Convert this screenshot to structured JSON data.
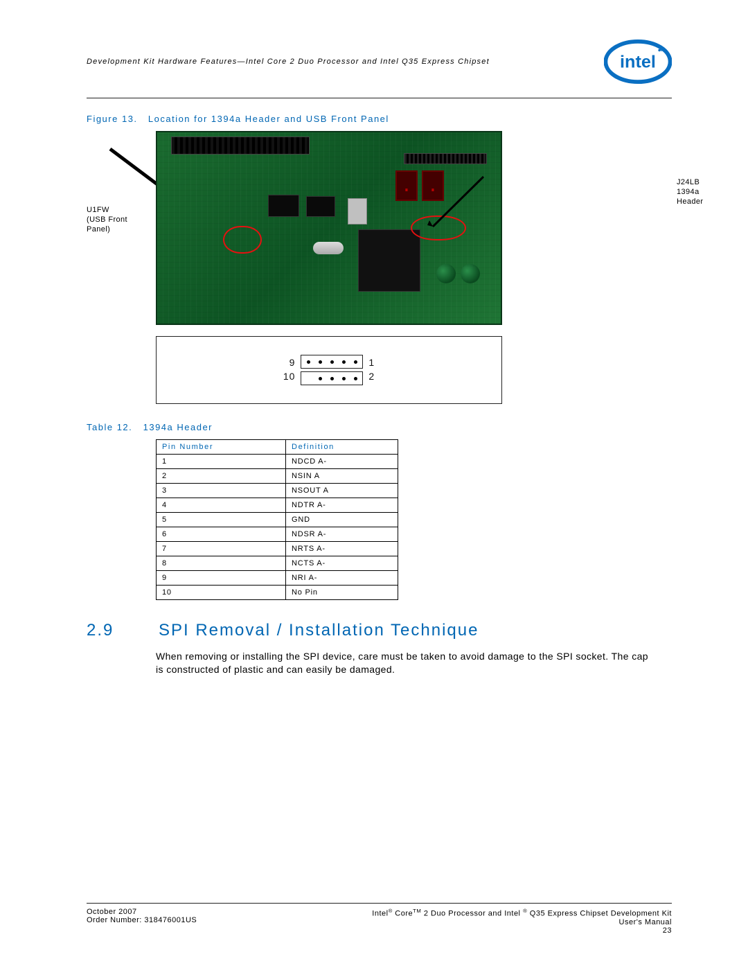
{
  "header": {
    "text": "Development Kit Hardware Features—Intel Core 2 Duo Processor and Intel Q35 Express Chipset"
  },
  "logo": {
    "name": "intel-logo"
  },
  "figure": {
    "label": "Figure 13.",
    "title": "Location for 1394a Header and USB Front Panel",
    "callout_left_l1": "U1FW",
    "callout_left_l2": "(USB Front",
    "callout_left_l3": "Panel)",
    "callout_right_l1": "J24LB",
    "callout_right_l2": "1394a",
    "callout_right_l3": "Header"
  },
  "pinout": {
    "top_left": "9",
    "bot_left": "10",
    "top_right": "1",
    "bot_right": "2"
  },
  "table": {
    "label": "Table 12.",
    "title": "1394a Header",
    "col1": "Pin Number",
    "col2": "Definition",
    "rows": [
      {
        "pin": "1",
        "def": "NDCD A-"
      },
      {
        "pin": "2",
        "def": "NSIN A"
      },
      {
        "pin": "3",
        "def": "NSOUT A"
      },
      {
        "pin": "4",
        "def": "NDTR A-"
      },
      {
        "pin": "5",
        "def": "GND"
      },
      {
        "pin": "6",
        "def": "NDSR A-"
      },
      {
        "pin": "7",
        "def": "NRTS A-"
      },
      {
        "pin": "8",
        "def": "NCTS A-"
      },
      {
        "pin": "9",
        "def": "NRI A-"
      },
      {
        "pin": "10",
        "def": "No Pin"
      }
    ]
  },
  "section": {
    "number": "2.9",
    "title": "SPI Removal / Installation Technique",
    "body": "When removing or installing the SPI device, care must be taken to avoid damage to the SPI socket. The cap is constructed of plastic and can easily be damaged."
  },
  "footer": {
    "left_l1": "October 2007",
    "left_l2": "Order Number: 318476001US",
    "right_l1_pre": "Intel",
    "right_l1_mid": " Core",
    "right_l1_mid2": " 2 Duo Processor and Intel ",
    "right_l1_post": " Q35 Express Chipset Development Kit",
    "right_l2": "User's Manual",
    "right_l3": "23"
  }
}
